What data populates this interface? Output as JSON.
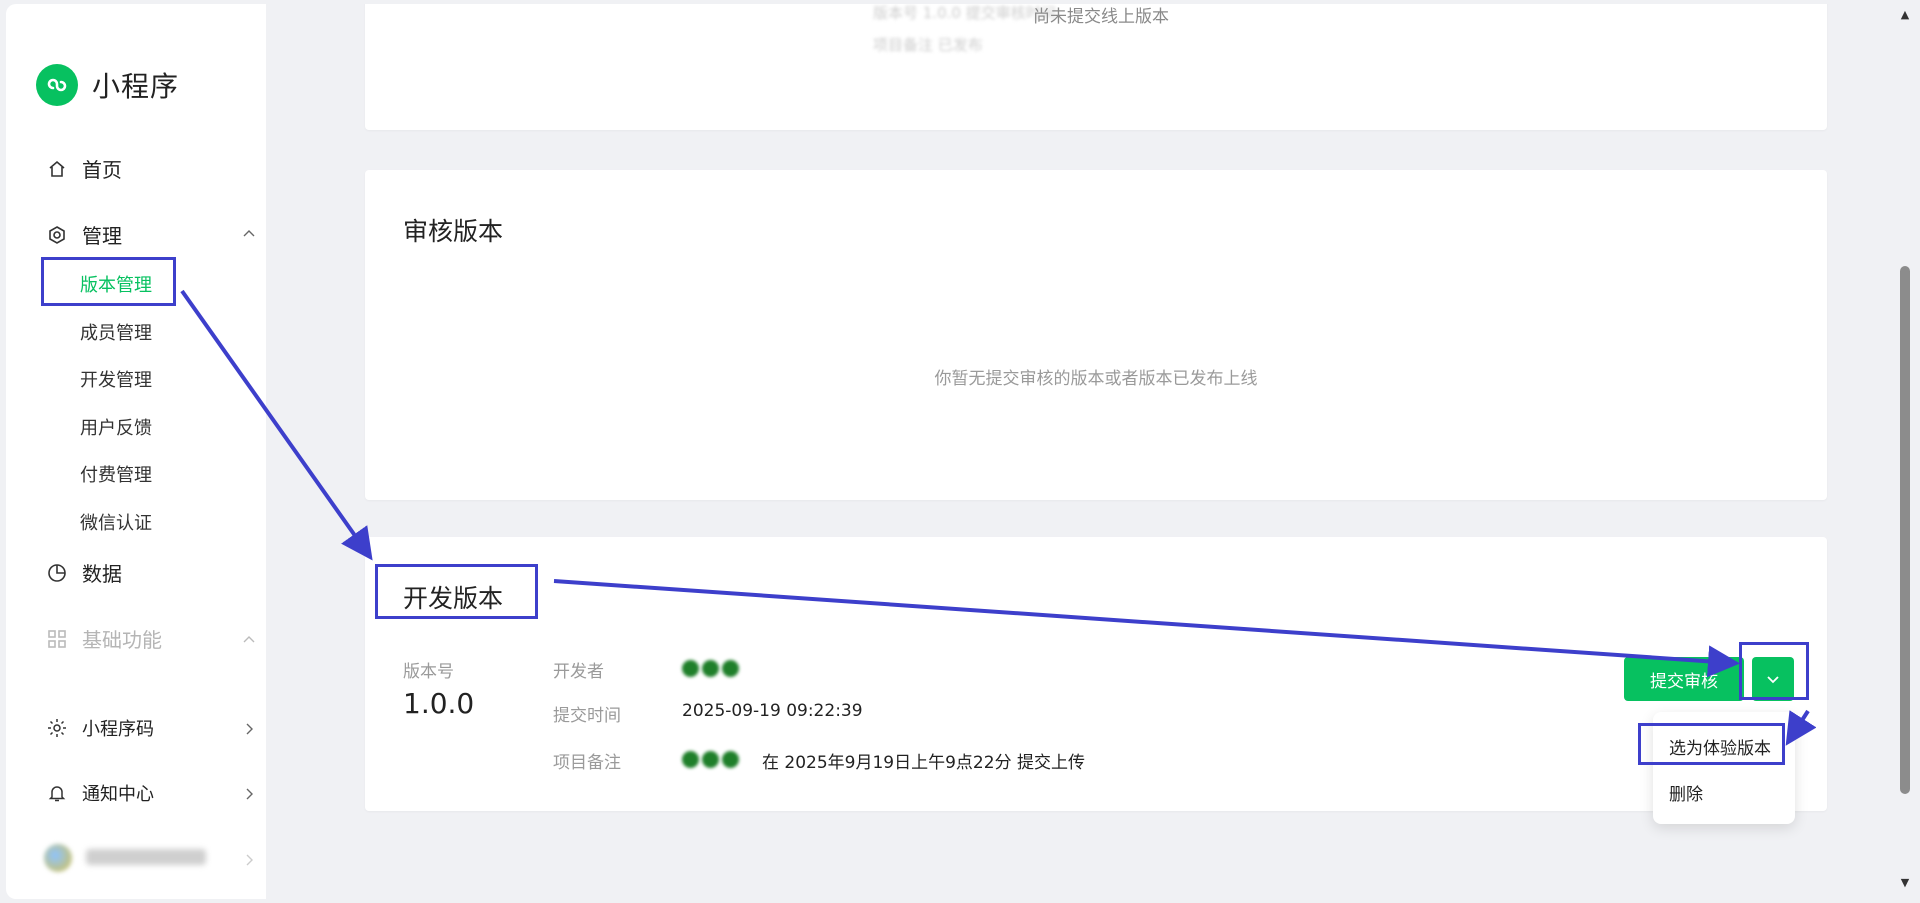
{
  "app": {
    "title": "小程序"
  },
  "sidebar": {
    "home": "首页",
    "manage": "管理",
    "sub_items": [
      "版本管理",
      "成员管理",
      "开发管理",
      "用户反馈",
      "付费管理",
      "微信认证"
    ],
    "data": "数据",
    "basic": "基础功能",
    "mini_code": "小程序码",
    "notify": "通知中心",
    "user_name": "一起来学习Dario"
  },
  "top_card": {
    "status": "尚未提交线上版本",
    "faded_line1": "版本号 1.0.0 提交审核时间",
    "faded_line2": "项目备注 已发布"
  },
  "review_card": {
    "title": "审核版本",
    "empty": "你暂无提交审核的版本或者版本已发布上线"
  },
  "dev_card": {
    "title": "开发版本",
    "version_label": "版本号",
    "version": "1.0.0",
    "developer_label": "开发者",
    "time_label": "提交时间",
    "time": "2025-09-19 09:22:39",
    "note_label": "项目备注",
    "note": "在 2025年9月19日上午9点22分 提交上传",
    "submit_button": "提交审核",
    "dropdown_options": [
      "选为体验版本",
      "删除"
    ]
  },
  "colors": {
    "brand": "#07c160",
    "annotation": "#3d3fcb"
  }
}
